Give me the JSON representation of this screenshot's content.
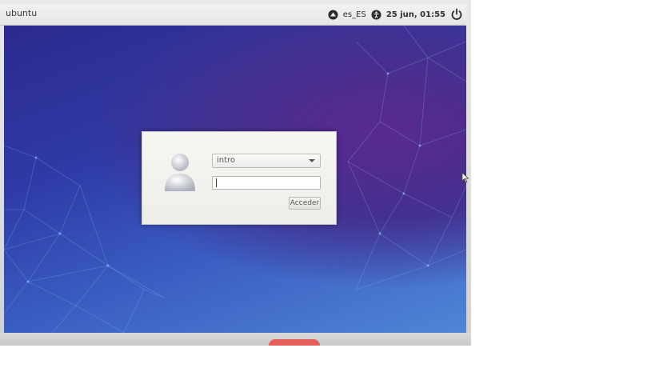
{
  "topbar": {
    "app_name": "ubuntu",
    "indicators": {
      "network_icon": "network-icon",
      "keyboard_layout": "es_ES",
      "accessibility_icon": "accessibility-icon",
      "clock": "25 jun, 01:55",
      "power_icon": "power-icon"
    }
  },
  "login": {
    "avatar_icon": "user-avatar-icon",
    "user_select_value": "intro",
    "password_value": "",
    "login_button_label": "Acceder"
  },
  "colors": {
    "wallpaper_dark": "#2c2a8e",
    "wallpaper_light": "#4f86d6",
    "wallpaper_purple": "#5a2a8e",
    "panel": "#e6e6e4",
    "dialog": "#f2f1ee",
    "power_led": "#e4605a"
  }
}
